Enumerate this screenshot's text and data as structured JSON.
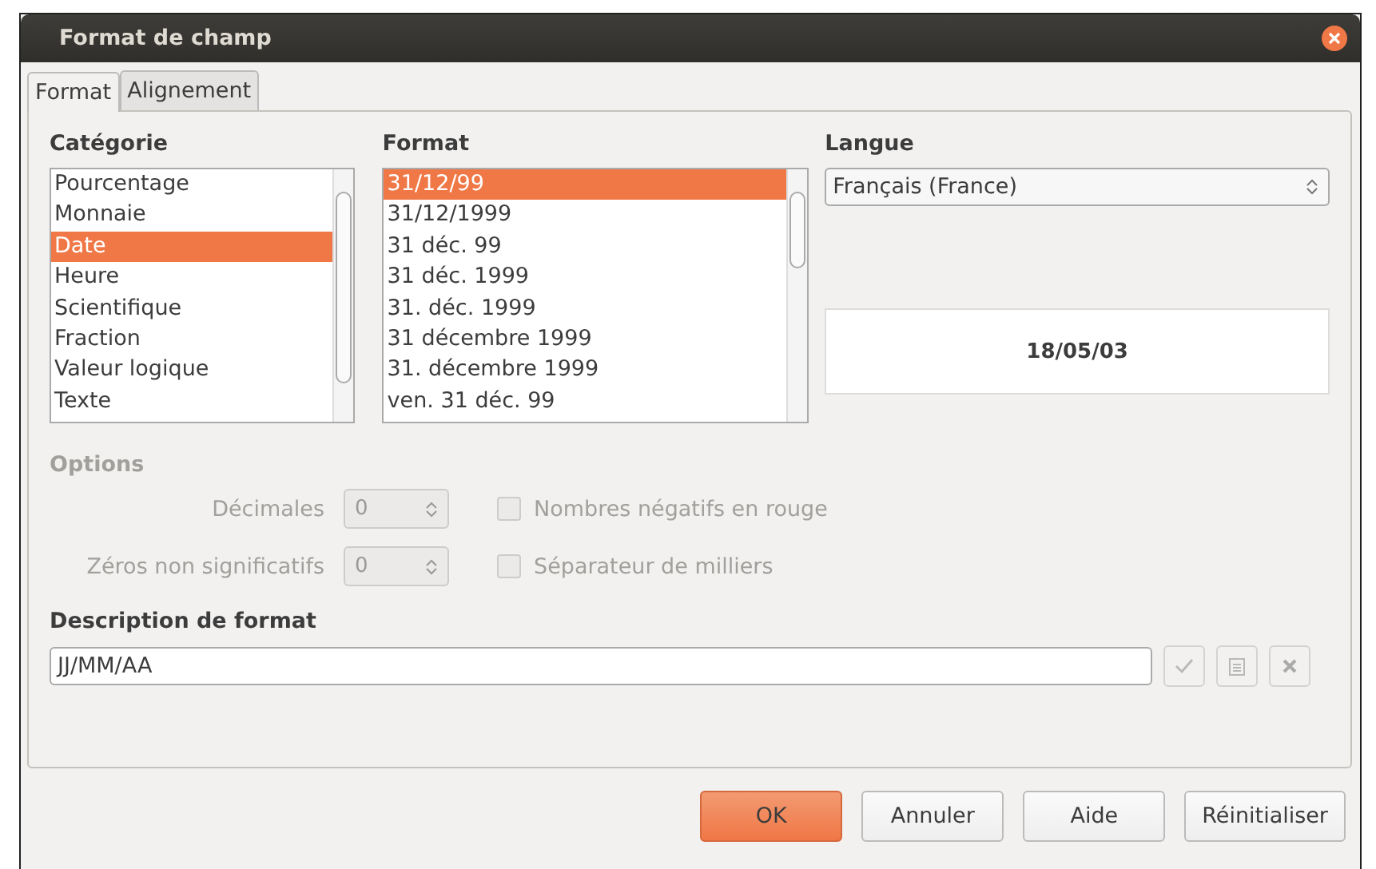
{
  "window": {
    "title": "Format de champ"
  },
  "tabs": [
    {
      "label": "Format",
      "selected": true
    },
    {
      "label": "Alignement",
      "selected": false
    }
  ],
  "category": {
    "label": "Catégorie",
    "items": [
      {
        "label": "Pourcentage",
        "selected": false
      },
      {
        "label": "Monnaie",
        "selected": false
      },
      {
        "label": "Date",
        "selected": true
      },
      {
        "label": "Heure",
        "selected": false
      },
      {
        "label": "Scientifique",
        "selected": false
      },
      {
        "label": "Fraction",
        "selected": false
      },
      {
        "label": "Valeur logique",
        "selected": false
      },
      {
        "label": "Texte",
        "selected": false
      }
    ]
  },
  "format": {
    "label": "Format",
    "items": [
      {
        "label": "31/12/99",
        "selected": true
      },
      {
        "label": "31/12/1999",
        "selected": false
      },
      {
        "label": "31 déc. 99",
        "selected": false
      },
      {
        "label": "31 déc. 1999",
        "selected": false
      },
      {
        "label": "31. déc. 1999",
        "selected": false
      },
      {
        "label": "31 décembre 1999",
        "selected": false
      },
      {
        "label": "31. décembre 1999",
        "selected": false
      },
      {
        "label": "ven. 31 déc. 99",
        "selected": false
      }
    ]
  },
  "language": {
    "label": "Langue",
    "value": "Français (France)"
  },
  "preview": "18/05/03",
  "options": {
    "label": "Options",
    "disabled": true,
    "spins": [
      {
        "label": "Décimales",
        "value": "0"
      },
      {
        "label": "Zéros non significatifs",
        "value": "0"
      }
    ],
    "checkboxes": [
      {
        "label": "Nombres négatifs en rouge",
        "checked": false
      },
      {
        "label": "Séparateur de milliers",
        "checked": false
      }
    ]
  },
  "format_code": {
    "label": "Description de format",
    "value": "JJ/MM/AA",
    "buttons_disabled": true
  },
  "buttons": [
    {
      "label": "OK",
      "default": true
    },
    {
      "label": "Annuler",
      "default": false
    },
    {
      "label": "Aide",
      "default": false
    },
    {
      "label": "Réinitialiser",
      "default": false
    }
  ]
}
